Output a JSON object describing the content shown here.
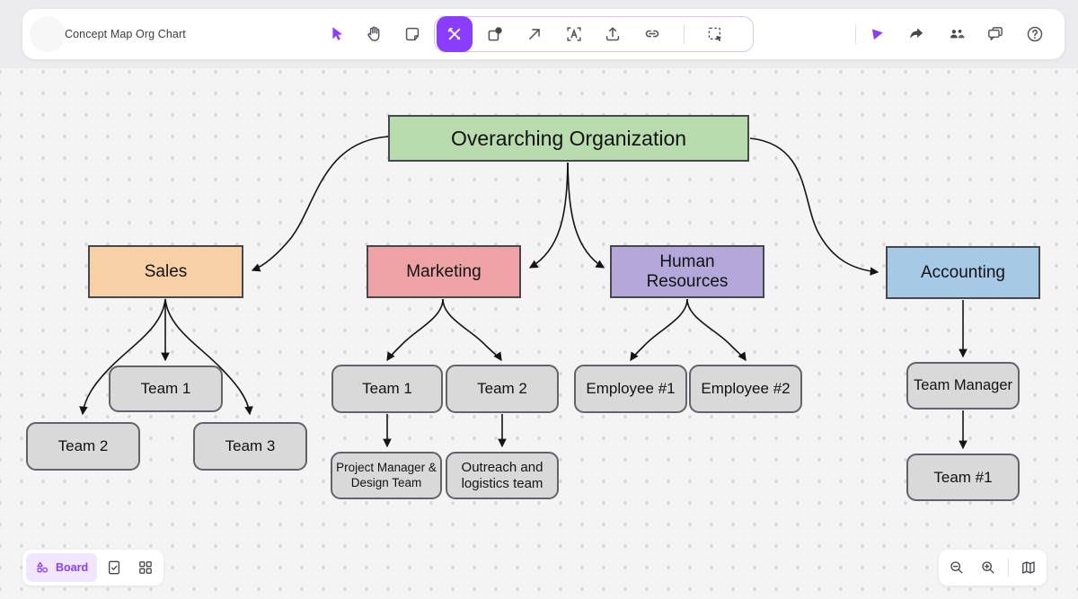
{
  "header": {
    "title": "Concept Map Org Chart",
    "toolbar_icons": [
      "select-cursor",
      "hand",
      "sticky-note",
      "tools",
      "shapes",
      "arrow",
      "text-frame",
      "upload",
      "link",
      "marquee-select"
    ],
    "right_icons": [
      "laser-pointer",
      "share",
      "collaborators",
      "comments",
      "help"
    ]
  },
  "canvas": {
    "nodes": [
      {
        "id": "overarching",
        "label": "Overarching Organization",
        "fill": "#b9dcae"
      },
      {
        "id": "sales",
        "label": "Sales",
        "fill": "#f7d1a5"
      },
      {
        "id": "marketing",
        "label": "Marketing",
        "fill": "#eda3a6"
      },
      {
        "id": "human-resources",
        "label": "Human Resources",
        "fill": "#b4a8da"
      },
      {
        "id": "accounting",
        "label": "Accounting",
        "fill": "#a6c9e6"
      },
      {
        "id": "sales-team-1",
        "label": "Team 1",
        "fill": "#d9d9d9"
      },
      {
        "id": "sales-team-2",
        "label": "Team 2",
        "fill": "#d9d9d9"
      },
      {
        "id": "sales-team-3",
        "label": "Team 3",
        "fill": "#d9d9d9"
      },
      {
        "id": "marketing-team-1",
        "label": "Team 1",
        "fill": "#d9d9d9"
      },
      {
        "id": "marketing-team-2",
        "label": "Team 2",
        "fill": "#d9d9d9"
      },
      {
        "id": "pm-design-team",
        "label": "Project Manager & Design Team",
        "fill": "#d9d9d9"
      },
      {
        "id": "outreach-logistics",
        "label": "Outreach and logistics team",
        "fill": "#d9d9d9"
      },
      {
        "id": "employee-1",
        "label": "Employee #1",
        "fill": "#d9d9d9"
      },
      {
        "id": "employee-2",
        "label": "Employee #2",
        "fill": "#d9d9d9"
      },
      {
        "id": "team-manager",
        "label": "Team Manager",
        "fill": "#d9d9d9"
      },
      {
        "id": "team-number-1",
        "label": "Team #1",
        "fill": "#d9d9d9"
      }
    ],
    "edges": [
      {
        "from": "overarching",
        "to": "sales"
      },
      {
        "from": "overarching",
        "to": "marketing"
      },
      {
        "from": "overarching",
        "to": "human-resources"
      },
      {
        "from": "overarching",
        "to": "accounting"
      },
      {
        "from": "sales",
        "to": "sales-team-1"
      },
      {
        "from": "sales",
        "to": "sales-team-2"
      },
      {
        "from": "sales",
        "to": "sales-team-3"
      },
      {
        "from": "marketing",
        "to": "marketing-team-1"
      },
      {
        "from": "marketing",
        "to": "marketing-team-2"
      },
      {
        "from": "marketing-team-1",
        "to": "pm-design-team"
      },
      {
        "from": "marketing-team-2",
        "to": "outreach-logistics"
      },
      {
        "from": "human-resources",
        "to": "employee-1"
      },
      {
        "from": "human-resources",
        "to": "employee-2"
      },
      {
        "from": "accounting",
        "to": "team-manager"
      },
      {
        "from": "team-manager",
        "to": "team-number-1"
      }
    ]
  },
  "footer": {
    "board_label": "Board",
    "left_icons": [
      "board-shapes",
      "checklist",
      "grid"
    ],
    "right_icons": [
      "zoom-out",
      "zoom-in",
      "map"
    ]
  },
  "colors": {
    "accent": "#8b3dff",
    "accent_soft": "#f1e6ff",
    "icon_gray": "#55555c",
    "edge": "#141414",
    "canvas_bg": "#f5f4f5",
    "node_gray": "#d9d9d9"
  }
}
